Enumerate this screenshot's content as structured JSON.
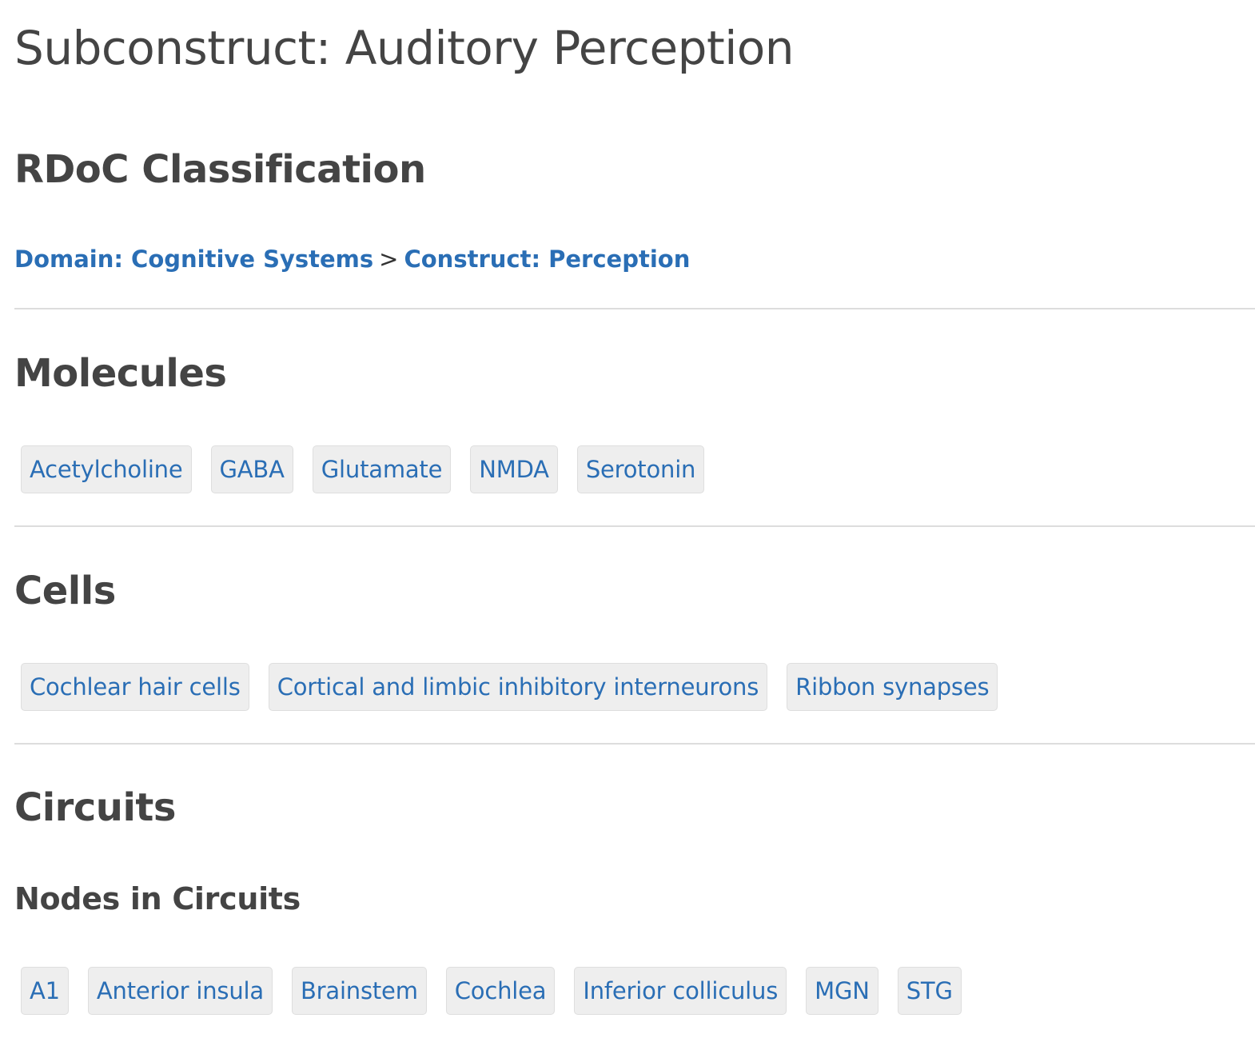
{
  "page": {
    "title": "Subconstruct: Auditory Perception"
  },
  "classification": {
    "heading": "RDoC Classification",
    "domain_link": "Domain: Cognitive Systems",
    "separator": ">",
    "construct_link": "Construct: Perception"
  },
  "molecules": {
    "heading": "Molecules",
    "tags": [
      "Acetylcholine",
      "GABA",
      "Glutamate",
      "NMDA",
      "Serotonin"
    ]
  },
  "cells": {
    "heading": "Cells",
    "tags": [
      "Cochlear hair cells",
      "Cortical and limbic inhibitory interneurons",
      "Ribbon synapses"
    ]
  },
  "circuits": {
    "heading": "Circuits",
    "nodes_heading": "Nodes in Circuits",
    "tags": [
      "A1",
      "Anterior insula",
      "Brainstem",
      "Cochlea",
      "Inferior colliculus",
      "MGN",
      "STG"
    ]
  },
  "colors": {
    "link": "#2a6eb5",
    "heading_text": "#444444",
    "tag_background": "#eeeeee",
    "divider": "#dddddd"
  }
}
